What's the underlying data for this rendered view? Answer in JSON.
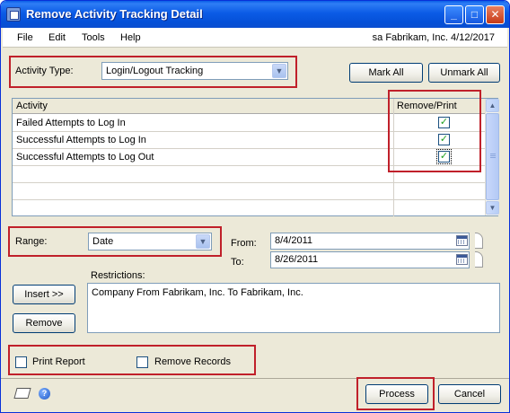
{
  "window": {
    "title": "Remove Activity Tracking Detail",
    "min_glyph": "_",
    "max_glyph": "□",
    "close_glyph": "✕"
  },
  "menu": {
    "items": [
      "File",
      "Edit",
      "Tools",
      "Help"
    ],
    "user_info": "sa  Fabrikam, Inc.  4/12/2017"
  },
  "activity_type": {
    "label": "Activity Type:",
    "selected": "Login/Logout Tracking"
  },
  "buttons": {
    "mark_all": "Mark All",
    "unmark_all": "Unmark All",
    "insert": "Insert >>",
    "remove": "Remove",
    "process": "Process",
    "cancel": "Cancel"
  },
  "grid": {
    "columns": [
      "Activity",
      "Remove/Print"
    ],
    "rows": [
      {
        "activity": "Failed Attempts to Log In",
        "checked": true
      },
      {
        "activity": "Successful Attempts to Log In",
        "checked": true
      },
      {
        "activity": "Successful Attempts to Log Out",
        "checked": true
      },
      {
        "activity": "",
        "checked": false
      },
      {
        "activity": "",
        "checked": false
      },
      {
        "activity": "",
        "checked": false
      }
    ]
  },
  "range": {
    "label": "Range:",
    "selected": "Date",
    "from_label": "From:",
    "from_value": "8/4/2011",
    "to_label": "To:",
    "to_value": "8/26/2011"
  },
  "restrictions": {
    "label": "Restrictions:",
    "value": "Company From Fabrikam, Inc. To  Fabrikam, Inc."
  },
  "options": {
    "print_report": "Print Report",
    "remove_records": "Remove Records"
  },
  "colors": {
    "titlebar": "#0550d7",
    "highlight_box": "#c0202a",
    "check": "#21a121"
  }
}
